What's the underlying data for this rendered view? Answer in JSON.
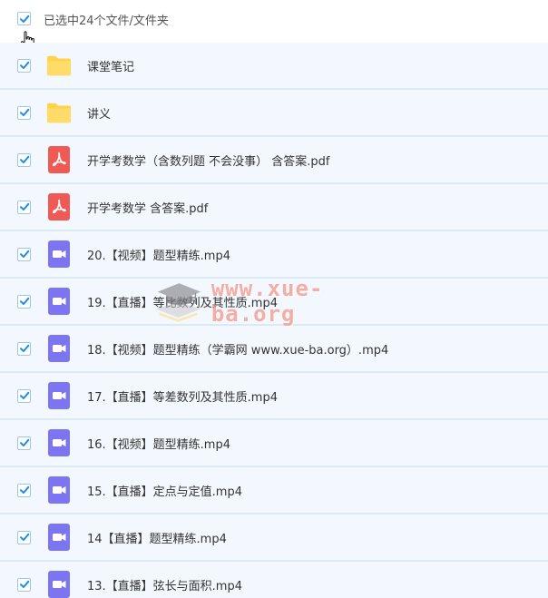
{
  "header": {
    "selection_label": "已选中24个文件/文件夹",
    "checked": true
  },
  "colors": {
    "check": "#1a8fe3",
    "row_bg": "#f3f8fe",
    "row_border": "#dbe9f7",
    "folder": "#ffd24d",
    "pdf": "#f05a55",
    "video": "#7c74f0"
  },
  "files": [
    {
      "name": "课堂笔记",
      "type": "folder",
      "icon": "folder-icon",
      "checked": true
    },
    {
      "name": "讲义",
      "type": "folder",
      "icon": "folder-icon",
      "checked": true
    },
    {
      "name": "开学考数学（含数列题 不会没事） 含答案.pdf",
      "type": "pdf",
      "icon": "pdf-icon",
      "checked": true
    },
    {
      "name": "开学考数学 含答案.pdf",
      "type": "pdf",
      "icon": "pdf-icon",
      "checked": true
    },
    {
      "name": "20.【视频】题型精练.mp4",
      "type": "video",
      "icon": "video-icon",
      "checked": true
    },
    {
      "name": "19.【直播】等比数列及其性质.mp4",
      "type": "video",
      "icon": "video-icon",
      "checked": true
    },
    {
      "name": "18.【视频】题型精练（学霸网 www.xue-ba.org）.mp4",
      "type": "video",
      "icon": "video-icon",
      "checked": true
    },
    {
      "name": "17.【直播】等差数列及其性质.mp4",
      "type": "video",
      "icon": "video-icon",
      "checked": true
    },
    {
      "name": "16.【视频】题型精练.mp4",
      "type": "video",
      "icon": "video-icon",
      "checked": true
    },
    {
      "name": "15.【直播】定点与定值.mp4",
      "type": "video",
      "icon": "video-icon",
      "checked": true
    },
    {
      "name": "14【直播】题型精练.mp4",
      "type": "video",
      "icon": "video-icon",
      "checked": true
    },
    {
      "name": "13.【直播】弦长与面积.mp4",
      "type": "video",
      "icon": "video-icon",
      "checked": true
    }
  ],
  "watermark": {
    "text": "www.xue-ba.org",
    "icon": "graduation-cap-icon"
  }
}
